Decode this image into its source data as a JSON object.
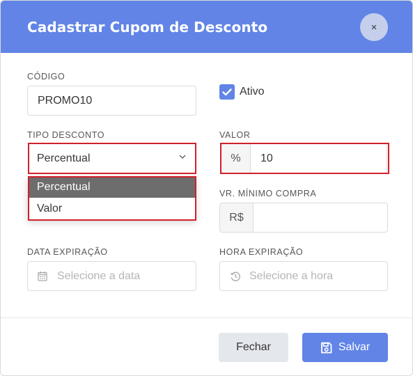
{
  "modal": {
    "title": "Cadastrar Cupom de Desconto",
    "close_label": "×"
  },
  "form": {
    "codigo": {
      "label": "CÓDIGO",
      "value": "PROMO10"
    },
    "ativo": {
      "label": "Ativo",
      "checked": true
    },
    "tipo_desconto": {
      "label": "TIPO DESCONTO",
      "value": "Percentual",
      "options": [
        "Percentual",
        "Valor"
      ]
    },
    "valor": {
      "label": "VALOR",
      "addon": "%",
      "value": "10"
    },
    "vr_minimo": {
      "label": "VR. MÍNIMO COMPRA",
      "addon": "R$",
      "value": ""
    },
    "data_expiracao": {
      "label": "DATA EXPIRAÇÃO",
      "placeholder": "Selecione a data"
    },
    "hora_expiracao": {
      "label": "HORA EXPIRAÇÃO",
      "placeholder": "Selecione a hora"
    }
  },
  "footer": {
    "cancel_label": "Fechar",
    "save_label": "Salvar"
  },
  "colors": {
    "accent": "#6184e6",
    "highlight": "#d0202a"
  },
  "icons": {
    "close": "close-icon",
    "check": "check-icon",
    "chevron": "chevron-down-icon",
    "calendar": "calendar-icon",
    "clock": "clock-history-icon",
    "save": "floppy-disk-icon"
  }
}
